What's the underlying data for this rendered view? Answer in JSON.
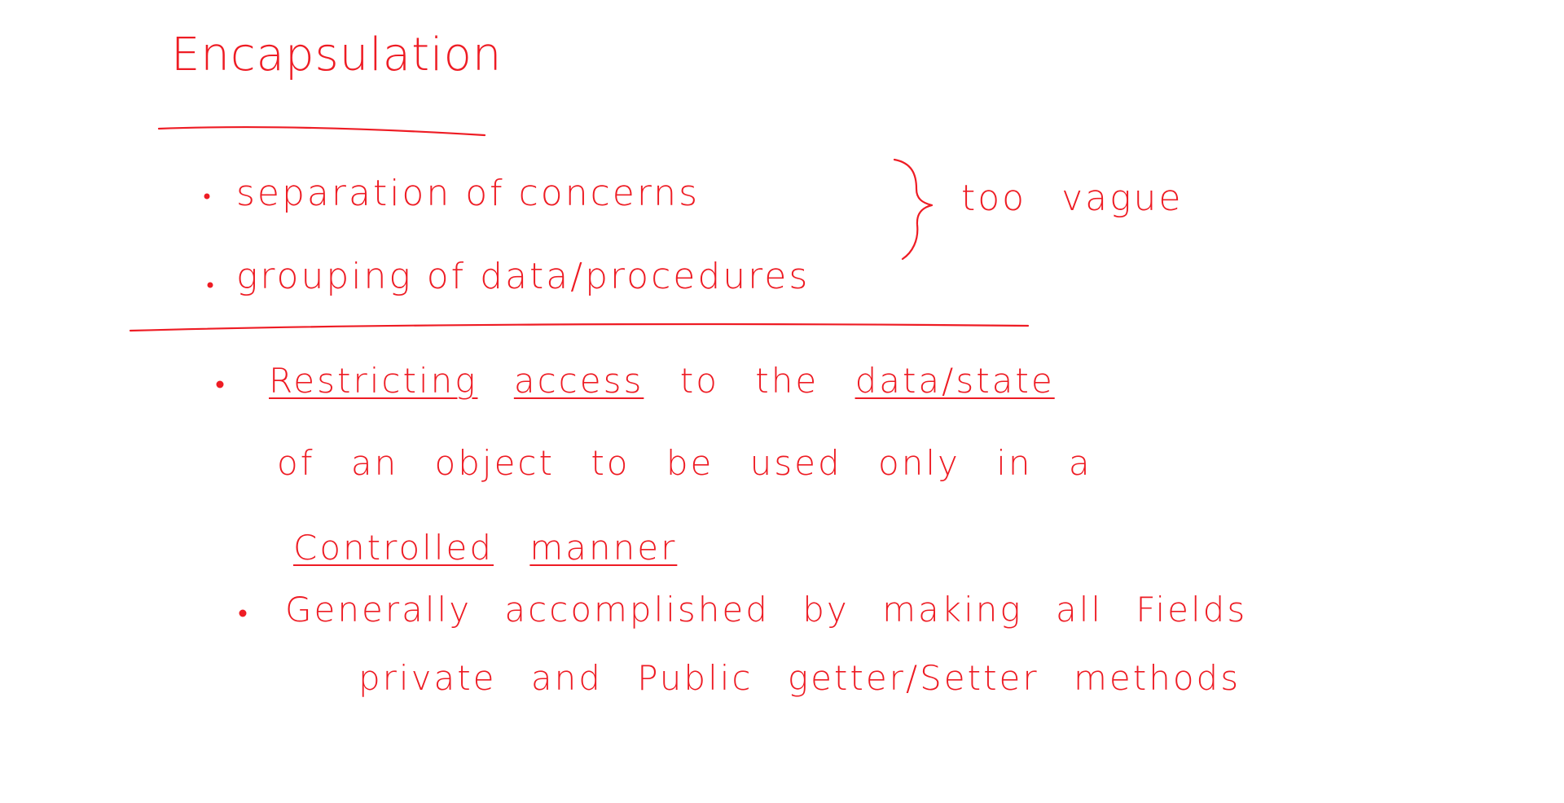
{
  "ink_color": "#ee1c24",
  "title": "Encapsulation",
  "vague_group": {
    "items": [
      "separation of concerns",
      "grouping of data/procedures"
    ],
    "brace_note": "too vague"
  },
  "definition": {
    "bullet_1": {
      "line1_words": [
        "Restricting",
        "access",
        "to",
        "the",
        "data/state"
      ],
      "line2": "of an object to be used only in a",
      "line3_words": [
        "Controlled",
        "manner"
      ]
    },
    "bullet_2": {
      "line1": "Generally accomplished by making all Fields",
      "line2": "private and Public getter/Setter methods"
    }
  }
}
